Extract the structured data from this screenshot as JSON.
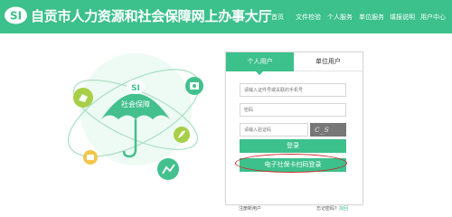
{
  "header": {
    "title": "自贡市人力资源和社会保障网上办事大厅",
    "logo_icon": "si-logo-icon",
    "nav": [
      "首页",
      "文件检验",
      "个人服务",
      "单位服务",
      "填报说明",
      "用户中心"
    ]
  },
  "illustration": {
    "umbrella_label": "社会保障",
    "icons": [
      "briefcase-icon",
      "document-icon",
      "leaf-icon",
      "chart-icon",
      "wallet-icon"
    ]
  },
  "login": {
    "tabs": [
      "个人用户",
      "单位用户"
    ],
    "active_tab": 0,
    "id_placeholder": "请输入证件号或关联的手机号",
    "password_placeholder": "密码",
    "captcha_placeholder": "请输入验证码",
    "captcha_text": "c_s",
    "login_button": "登录",
    "qr_login_button": "电子社保卡扫码登录",
    "register_prefix": "注册新用户",
    "forgot_prefix": "忘记密码？",
    "forgot_link": "找回"
  },
  "colors": {
    "brand": "#3cc08c",
    "highlight_oval": "#cc2a2a"
  }
}
